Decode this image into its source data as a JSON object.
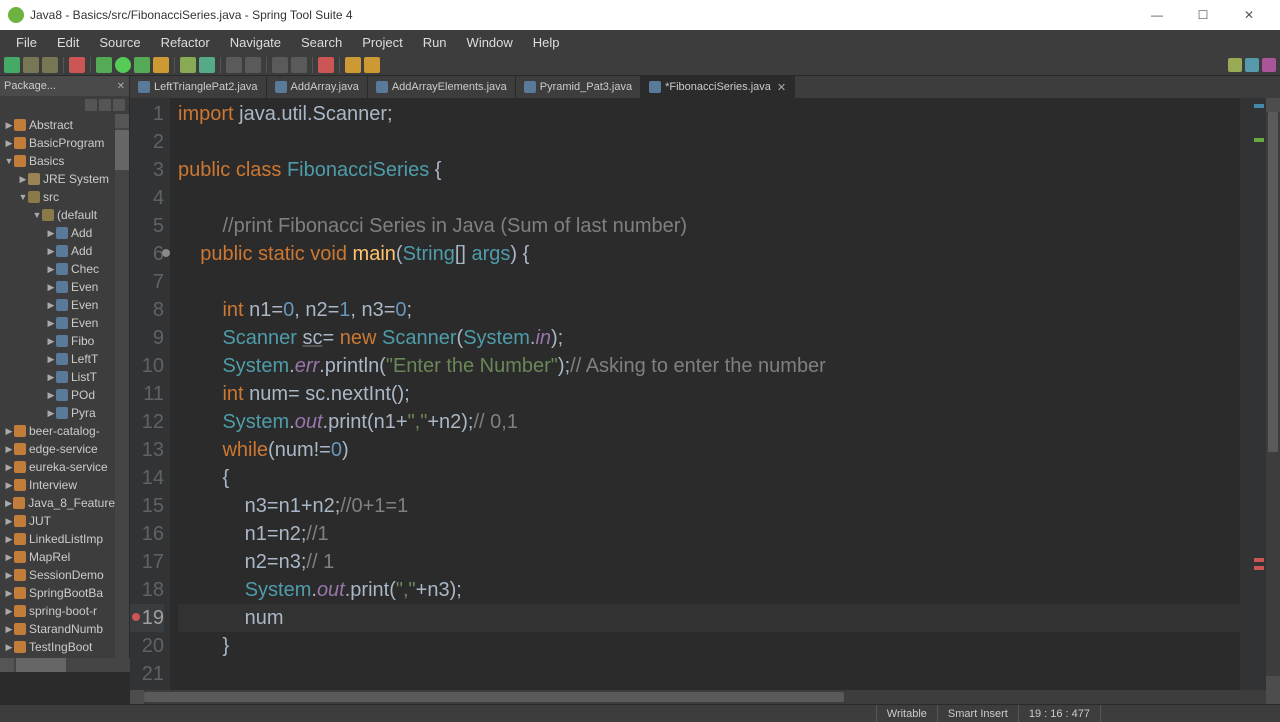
{
  "window": {
    "title": "Java8 - Basics/src/FibonacciSeries.java - Spring Tool Suite 4"
  },
  "menubar": [
    "File",
    "Edit",
    "Source",
    "Refactor",
    "Navigate",
    "Search",
    "Project",
    "Run",
    "Window",
    "Help"
  ],
  "sidebar": {
    "title": "Package...",
    "items": [
      {
        "level": 0,
        "twisty": "▶",
        "icon": "proj",
        "label": "Abstract"
      },
      {
        "level": 0,
        "twisty": "▶",
        "icon": "proj",
        "label": "BasicProgram"
      },
      {
        "level": 0,
        "twisty": "▼",
        "icon": "proj",
        "label": "Basics"
      },
      {
        "level": 1,
        "twisty": "▶",
        "icon": "folder",
        "label": "JRE System"
      },
      {
        "level": 1,
        "twisty": "▼",
        "icon": "pkg",
        "label": "src"
      },
      {
        "level": 2,
        "twisty": "▼",
        "icon": "pkg",
        "label": "(default"
      },
      {
        "level": 3,
        "twisty": "▶",
        "icon": "file",
        "label": "Add"
      },
      {
        "level": 3,
        "twisty": "▶",
        "icon": "file",
        "label": "Add"
      },
      {
        "level": 3,
        "twisty": "▶",
        "icon": "file",
        "label": "Chec"
      },
      {
        "level": 3,
        "twisty": "▶",
        "icon": "file",
        "label": "Even"
      },
      {
        "level": 3,
        "twisty": "▶",
        "icon": "file",
        "label": "Even"
      },
      {
        "level": 3,
        "twisty": "▶",
        "icon": "file",
        "label": "Even"
      },
      {
        "level": 3,
        "twisty": "▶",
        "icon": "file",
        "label": "Fibo"
      },
      {
        "level": 3,
        "twisty": "▶",
        "icon": "file",
        "label": "LeftT"
      },
      {
        "level": 3,
        "twisty": "▶",
        "icon": "file",
        "label": "ListT"
      },
      {
        "level": 3,
        "twisty": "▶",
        "icon": "file",
        "label": "POd"
      },
      {
        "level": 3,
        "twisty": "▶",
        "icon": "file",
        "label": "Pyra"
      },
      {
        "level": 0,
        "twisty": "▶",
        "icon": "proj",
        "label": "beer-catalog-"
      },
      {
        "level": 0,
        "twisty": "▶",
        "icon": "proj",
        "label": "edge-service"
      },
      {
        "level": 0,
        "twisty": "▶",
        "icon": "proj",
        "label": "eureka-service"
      },
      {
        "level": 0,
        "twisty": "▶",
        "icon": "proj",
        "label": "Interview"
      },
      {
        "level": 0,
        "twisty": "▶",
        "icon": "proj",
        "label": "Java_8_Feature"
      },
      {
        "level": 0,
        "twisty": "▶",
        "icon": "proj",
        "label": "JUT"
      },
      {
        "level": 0,
        "twisty": "▶",
        "icon": "proj",
        "label": "LinkedListImp"
      },
      {
        "level": 0,
        "twisty": "▶",
        "icon": "proj",
        "label": "MapRel"
      },
      {
        "level": 0,
        "twisty": "▶",
        "icon": "proj",
        "label": "SessionDemo"
      },
      {
        "level": 0,
        "twisty": "▶",
        "icon": "proj",
        "label": "SpringBootBa"
      },
      {
        "level": 0,
        "twisty": "▶",
        "icon": "proj",
        "label": "spring-boot-r"
      },
      {
        "level": 0,
        "twisty": "▶",
        "icon": "proj",
        "label": "StarandNumb"
      },
      {
        "level": 0,
        "twisty": "▶",
        "icon": "proj",
        "label": "TestIngBoot"
      }
    ]
  },
  "tabs": [
    {
      "label": "LeftTrianglePat2.java",
      "active": false,
      "dirty": false
    },
    {
      "label": "AddArray.java",
      "active": false,
      "dirty": false
    },
    {
      "label": "AddArrayElements.java",
      "active": false,
      "dirty": false
    },
    {
      "label": "Pyramid_Pat3.java",
      "active": false,
      "dirty": false
    },
    {
      "label": "*FibonacciSeries.java",
      "active": true,
      "dirty": true
    }
  ],
  "code": {
    "lines": [
      {
        "n": 1,
        "tokens": [
          {
            "t": "import ",
            "c": "kw"
          },
          {
            "t": "java.util.Scanner;",
            "c": ""
          }
        ]
      },
      {
        "n": 2,
        "tokens": [
          {
            "t": "",
            "c": ""
          }
        ]
      },
      {
        "n": 3,
        "tokens": [
          {
            "t": "public class ",
            "c": "kw"
          },
          {
            "t": "FibonacciSeries",
            "c": "cls"
          },
          {
            "t": " {",
            "c": ""
          }
        ]
      },
      {
        "n": 4,
        "tokens": [
          {
            "t": "",
            "c": ""
          }
        ]
      },
      {
        "n": 5,
        "tokens": [
          {
            "t": "        ",
            "c": ""
          },
          {
            "t": "//print Fibonacci Series in Java (Sum of last number)",
            "c": "com"
          }
        ]
      },
      {
        "n": 6,
        "tokens": [
          {
            "t": "    ",
            "c": ""
          },
          {
            "t": "public static ",
            "c": "kw"
          },
          {
            "t": "void ",
            "c": "kw"
          },
          {
            "t": "main",
            "c": "mth"
          },
          {
            "t": "(",
            "c": ""
          },
          {
            "t": "String",
            "c": "type"
          },
          {
            "t": "[] ",
            "c": ""
          },
          {
            "t": "args",
            "c": "type"
          },
          {
            "t": ") {",
            "c": ""
          }
        ]
      },
      {
        "n": 7,
        "tokens": [
          {
            "t": "",
            "c": ""
          }
        ]
      },
      {
        "n": 8,
        "tokens": [
          {
            "t": "        ",
            "c": ""
          },
          {
            "t": "int ",
            "c": "kw"
          },
          {
            "t": "n1=",
            "c": ""
          },
          {
            "t": "0",
            "c": "num"
          },
          {
            "t": ", n2=",
            "c": ""
          },
          {
            "t": "1",
            "c": "num"
          },
          {
            "t": ", n3=",
            "c": ""
          },
          {
            "t": "0",
            "c": "num"
          },
          {
            "t": ";",
            "c": ""
          }
        ]
      },
      {
        "n": 9,
        "tokens": [
          {
            "t": "        ",
            "c": ""
          },
          {
            "t": "Scanner ",
            "c": "type"
          },
          {
            "t": "sc",
            "c": "underline"
          },
          {
            "t": "= ",
            "c": ""
          },
          {
            "t": "new ",
            "c": "kw"
          },
          {
            "t": "Scanner",
            "c": "type"
          },
          {
            "t": "(",
            "c": ""
          },
          {
            "t": "System",
            "c": "type"
          },
          {
            "t": ".",
            "c": ""
          },
          {
            "t": "in",
            "c": "fld"
          },
          {
            "t": ");",
            "c": ""
          }
        ]
      },
      {
        "n": 10,
        "tokens": [
          {
            "t": "        ",
            "c": ""
          },
          {
            "t": "System",
            "c": "type"
          },
          {
            "t": ".",
            "c": ""
          },
          {
            "t": "err",
            "c": "fld"
          },
          {
            "t": ".println(",
            "c": ""
          },
          {
            "t": "\"Enter the Number\"",
            "c": "str"
          },
          {
            "t": ");",
            "c": ""
          },
          {
            "t": "// Asking to enter the number",
            "c": "com"
          }
        ]
      },
      {
        "n": 11,
        "tokens": [
          {
            "t": "        ",
            "c": ""
          },
          {
            "t": "int ",
            "c": "kw"
          },
          {
            "t": "num= sc.nextInt();",
            "c": ""
          }
        ]
      },
      {
        "n": 12,
        "tokens": [
          {
            "t": "        ",
            "c": ""
          },
          {
            "t": "System",
            "c": "type"
          },
          {
            "t": ".",
            "c": ""
          },
          {
            "t": "out",
            "c": "fld"
          },
          {
            "t": ".print(n1+",
            "c": ""
          },
          {
            "t": "\",\"",
            "c": "str"
          },
          {
            "t": "+n2);",
            "c": ""
          },
          {
            "t": "// 0,1",
            "c": "com"
          }
        ]
      },
      {
        "n": 13,
        "tokens": [
          {
            "t": "        ",
            "c": ""
          },
          {
            "t": "while",
            "c": "kw"
          },
          {
            "t": "(num!=",
            "c": ""
          },
          {
            "t": "0",
            "c": "num"
          },
          {
            "t": ")",
            "c": ""
          }
        ]
      },
      {
        "n": 14,
        "tokens": [
          {
            "t": "        {",
            "c": ""
          }
        ]
      },
      {
        "n": 15,
        "tokens": [
          {
            "t": "            n3=n1+n2;",
            "c": ""
          },
          {
            "t": "//0+1=1",
            "c": "com"
          }
        ]
      },
      {
        "n": 16,
        "tokens": [
          {
            "t": "            n1=n2;",
            "c": ""
          },
          {
            "t": "//1",
            "c": "com"
          }
        ]
      },
      {
        "n": 17,
        "tokens": [
          {
            "t": "            n2=n3;",
            "c": ""
          },
          {
            "t": "// 1",
            "c": "com"
          }
        ]
      },
      {
        "n": 18,
        "tokens": [
          {
            "t": "            ",
            "c": ""
          },
          {
            "t": "System",
            "c": "type"
          },
          {
            "t": ".",
            "c": ""
          },
          {
            "t": "out",
            "c": "fld"
          },
          {
            "t": ".print(",
            "c": ""
          },
          {
            "t": "\",\"",
            "c": "str"
          },
          {
            "t": "+n3);",
            "c": ""
          }
        ]
      },
      {
        "n": 19,
        "tokens": [
          {
            "t": "            num",
            "c": ""
          }
        ],
        "hl": true,
        "error": true
      },
      {
        "n": 20,
        "tokens": [
          {
            "t": "        }",
            "c": ""
          }
        ]
      },
      {
        "n": 21,
        "tokens": [
          {
            "t": "",
            "c": ""
          }
        ]
      }
    ]
  },
  "status": {
    "writable": "Writable",
    "insert": "Smart Insert",
    "pos": "19 : 16 : 477"
  }
}
